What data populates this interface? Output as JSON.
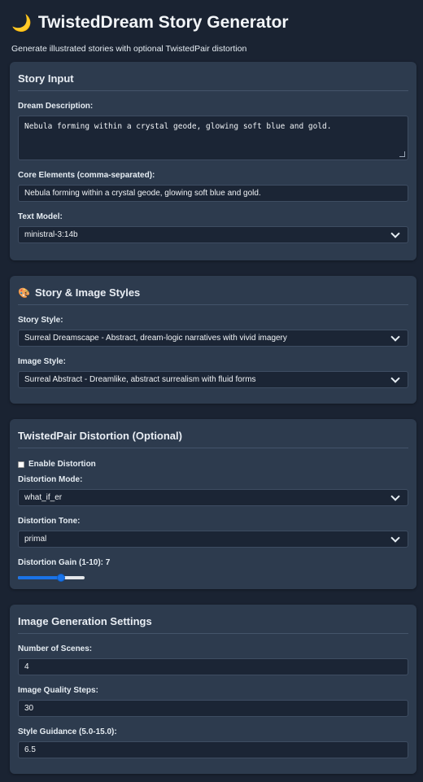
{
  "header": {
    "title": "TwistedDream Story Generator",
    "subtitle": "Generate illustrated stories with optional TwistedPair distortion",
    "icon": "crescent-moon-icon"
  },
  "story_input": {
    "title": "Story Input",
    "dream_label": "Dream Description:",
    "dream_value": "Nebula forming within a crystal geode, glowing soft blue and gold.",
    "core_label": "Core Elements (comma-separated):",
    "core_value": "Nebula forming within a crystal geode, glowing soft blue and gold.",
    "model_label": "Text Model:",
    "model_value": "ministral-3:14b"
  },
  "styles": {
    "title": "Story & Image Styles",
    "icon": "palette-icon",
    "story_label": "Story Style:",
    "story_value": "Surreal Dreamscape - Abstract, dream-logic narratives with vivid imagery",
    "image_label": "Image Style:",
    "image_value": "Surreal Abstract - Dreamlike, abstract surrealism with fluid forms"
  },
  "distortion": {
    "title": "TwistedPair Distortion (Optional)",
    "enable_label": "Enable Distortion",
    "enabled": false,
    "mode_label": "Distortion Mode:",
    "mode_value": "what_if_er",
    "tone_label": "Distortion Tone:",
    "tone_value": "primal",
    "gain_label": "Distortion Gain (1-10): 7",
    "gain": 7,
    "gain_min": 1,
    "gain_max": 10
  },
  "image_settings": {
    "title": "Image Generation Settings",
    "scenes_label": "Number of Scenes:",
    "scenes_value": "4",
    "steps_label": "Image Quality Steps:",
    "steps_value": "30",
    "guidance_label": "Style Guidance (5.0-15.0):",
    "guidance_value": "6.5"
  },
  "colors": {
    "background": "#1a2332",
    "card": "#2d3b4e",
    "input": "#1b2535",
    "accent": "#1a73e8",
    "moon": "#f6c94d"
  }
}
